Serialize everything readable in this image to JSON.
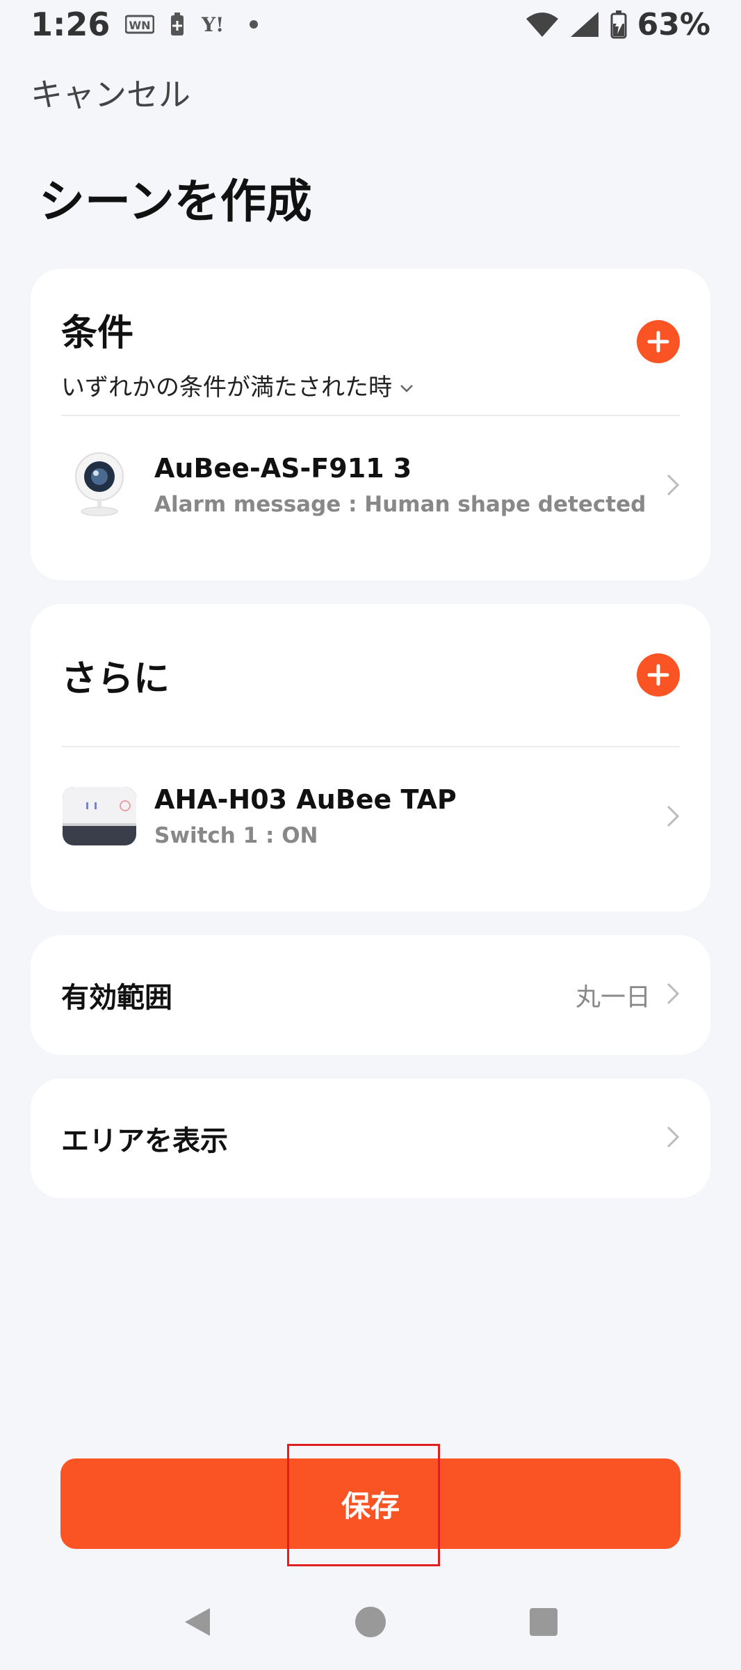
{
  "status_bar": {
    "time": "1:26",
    "battery_percent": "63%",
    "notification_icons": [
      "wn-icon",
      "battery-saver-icon",
      "yahoo-icon",
      "dot-icon"
    ]
  },
  "header": {
    "cancel_label": "キャンセル",
    "title": "シーンを作成"
  },
  "conditions": {
    "title": "条件",
    "mode": "いずれかの条件が満たされた時",
    "items": [
      {
        "name": "AuBee-AS-F911 3",
        "detail": "Alarm message : Human shape detected",
        "icon": "camera-icon"
      }
    ]
  },
  "actions": {
    "title": "さらに",
    "items": [
      {
        "name": "AHA-H03 AuBee TAP",
        "detail": "Switch 1 : ON",
        "icon": "smart-plug-icon"
      }
    ]
  },
  "effective_period": {
    "label": "有効範囲",
    "value": "丸一日"
  },
  "show_area": {
    "label": "エリアを表示"
  },
  "save_label": "保存",
  "colors": {
    "accent": "#fa5424",
    "background": "#f5f6fa",
    "card": "#ffffff"
  },
  "nav": [
    "back-icon",
    "home-icon",
    "recents-icon"
  ]
}
